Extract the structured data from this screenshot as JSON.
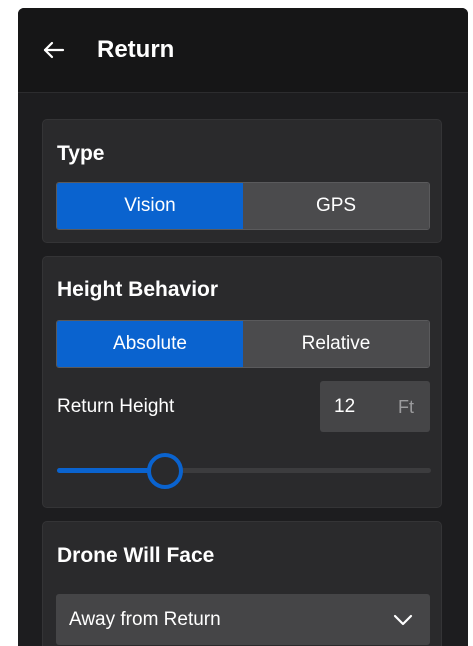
{
  "header": {
    "title": "Return",
    "back_icon": "arrow-left-icon"
  },
  "type_section": {
    "title": "Type",
    "options": [
      "Vision",
      "GPS"
    ],
    "selected": "Vision"
  },
  "height_section": {
    "title": "Height Behavior",
    "options": [
      "Absolute",
      "Relative"
    ],
    "selected": "Absolute",
    "return_height_label": "Return Height",
    "return_height_value": "12",
    "return_height_unit": "Ft",
    "slider_level_fraction": 0.29
  },
  "face_section": {
    "title": "Drone Will Face",
    "selected_value": "Away from Return",
    "dropdown_icon": "chevron-down-icon"
  },
  "colors": {
    "accent": "#0a63cf",
    "panel_bg": "#1d1d1f",
    "card_bg": "#2a2a2c",
    "control_bg": "#454547"
  }
}
